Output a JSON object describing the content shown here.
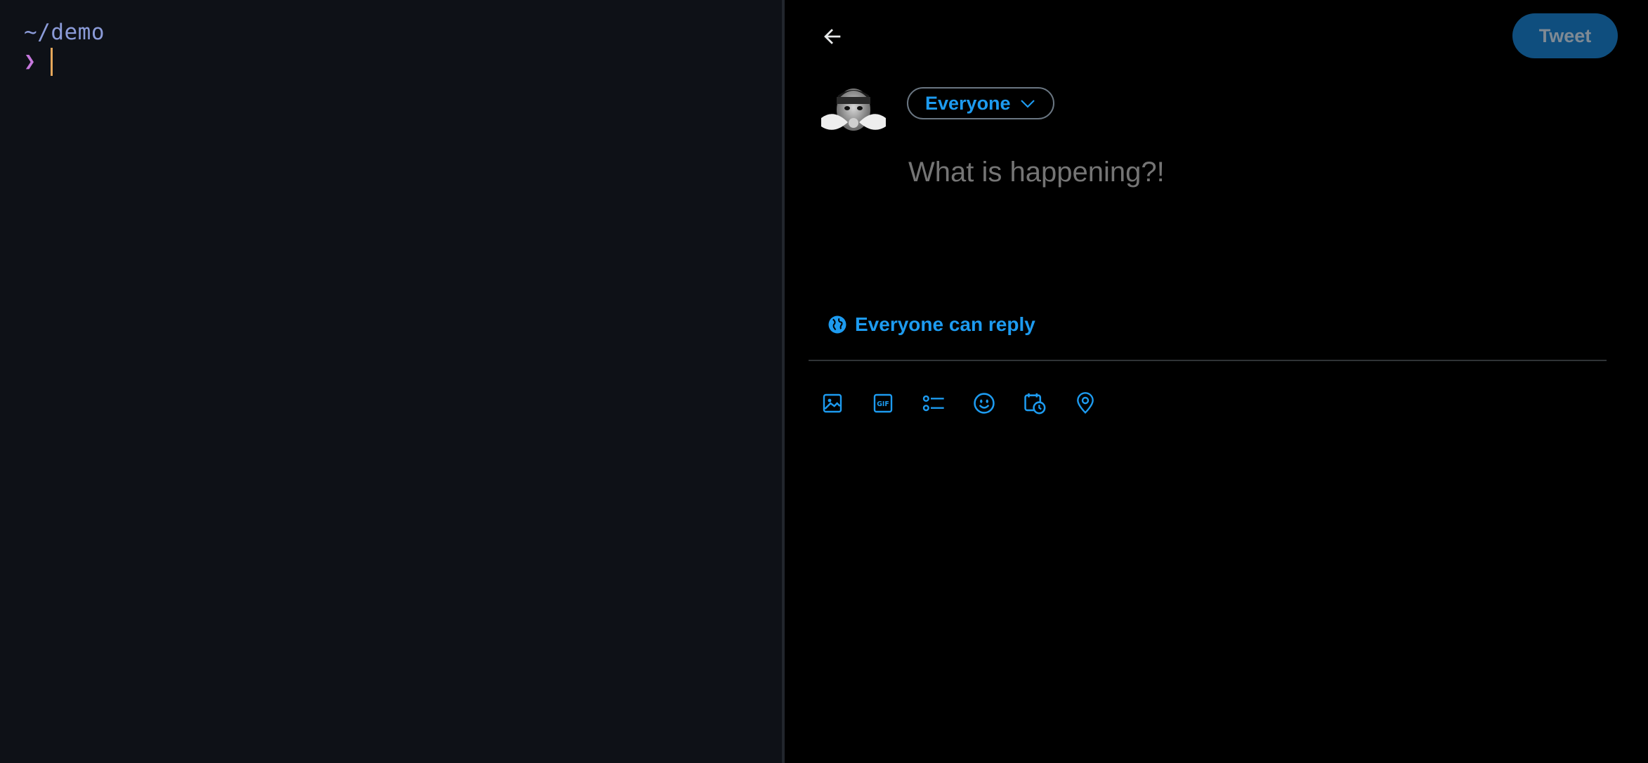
{
  "terminal": {
    "path": "~/demo",
    "prompt_symbol": "❯"
  },
  "compose": {
    "back_icon": "arrow-left-icon",
    "tweet_label": "Tweet",
    "audience_label": "Everyone",
    "placeholder": "What is happening?!",
    "reply_setting_label": "Everyone can reply",
    "toolbar": [
      "image-icon",
      "gif-icon",
      "poll-icon",
      "emoji-icon",
      "schedule-icon",
      "location-icon"
    ]
  },
  "colors": {
    "accent": "#1d9bf0",
    "tweet_button_bg": "#0f4e7e",
    "terminal_bg": "#0e1117",
    "terminal_path": "#8b9bd8",
    "prompt": "#c678dd",
    "cursor": "#e5a75b"
  }
}
